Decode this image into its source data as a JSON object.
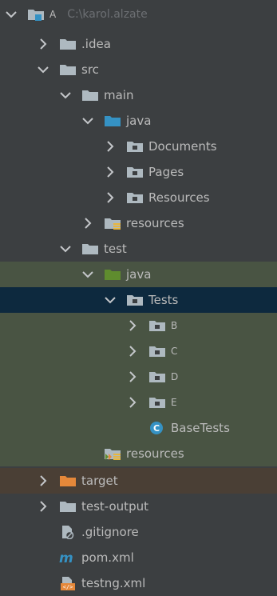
{
  "tree": {
    "root": {
      "name": "A",
      "path": "C:\\karol.alzate"
    },
    "idea": "idea",
    "idea_dot": ".",
    "src": "src",
    "main": "main",
    "main_java": "java",
    "documents": "Documents",
    "pages": "Pages",
    "resources_pkg": "Resources",
    "main_resources": "resources",
    "test": "test",
    "test_java": "java",
    "tests_pkg": "Tests",
    "b": "B",
    "c": "C",
    "d": "D",
    "e": "E",
    "base_tests": "BaseTests",
    "test_resources": "resources",
    "target": "target",
    "test_output": "test-output",
    "gitignore": ".gitignore",
    "pom": "pom.xml",
    "testng": "testng.xml"
  },
  "colors": {
    "background": "#3c3f41",
    "test_root_bg": "#495443",
    "selected_bg": "#0d293e",
    "excluded_bg": "#4a3f35",
    "folder_gray": "#aeb9c0",
    "source_blue": "#3592c4",
    "test_green": "#5f8c2e",
    "excluded_orange": "#e5883a"
  },
  "icons": {
    "folder": "folder-icon",
    "module": "module-icon",
    "source_root": "source-root-icon",
    "test_root": "test-root-icon",
    "package": "package-icon",
    "resources_root": "resources-root-icon",
    "test_resources_root": "test-resources-root-icon",
    "excluded": "excluded-folder-icon",
    "class": "class-icon",
    "gitignore": "gitignore-file-icon",
    "maven": "maven-icon",
    "xml": "xml-file-icon"
  }
}
